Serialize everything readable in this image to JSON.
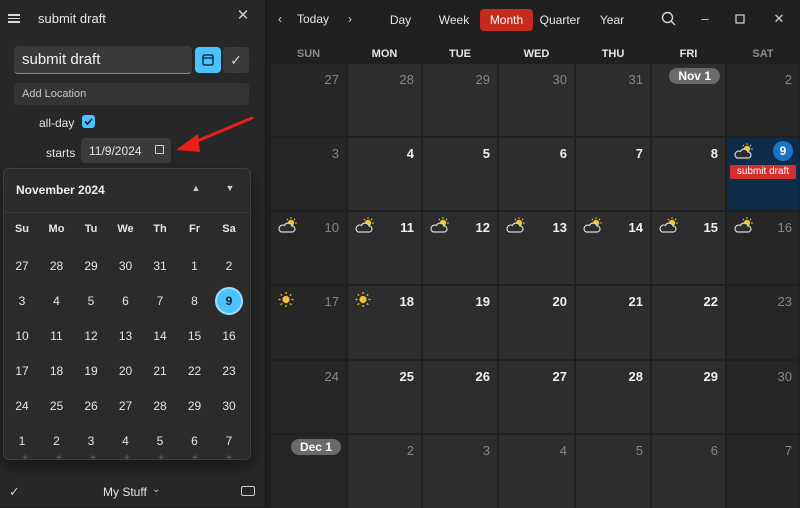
{
  "panel": {
    "title": "submit draft",
    "event_title": "submit draft",
    "location_placeholder": "Add Location",
    "allday_label": "all-day",
    "starts_label": "starts",
    "start_date": "11/9/2024",
    "footer_calendar": "My Stuff"
  },
  "picker": {
    "month_label": "November 2024",
    "weekdays": [
      "Su",
      "Mo",
      "Tu",
      "We",
      "Th",
      "Fr",
      "Sa"
    ],
    "weeks": [
      [
        "27",
        "28",
        "29",
        "30",
        "31",
        "1",
        "2"
      ],
      [
        "3",
        "4",
        "5",
        "6",
        "7",
        "8",
        "9"
      ],
      [
        "10",
        "11",
        "12",
        "13",
        "14",
        "15",
        "16"
      ],
      [
        "17",
        "18",
        "19",
        "20",
        "21",
        "22",
        "23"
      ],
      [
        "24",
        "25",
        "26",
        "27",
        "28",
        "29",
        "30"
      ],
      [
        "1",
        "2",
        "3",
        "4",
        "5",
        "6",
        "7"
      ]
    ],
    "selected_day": "9"
  },
  "toolbar": {
    "today": "Today",
    "views": [
      "Day",
      "Week",
      "Month",
      "Quarter",
      "Year"
    ],
    "active_view": "Month"
  },
  "calendar": {
    "weekday_headers": [
      "SUN",
      "MON",
      "TUE",
      "WED",
      "THU",
      "FRI",
      "SAT"
    ],
    "weeks": [
      [
        "27",
        "28",
        "29",
        "30",
        "31",
        "Nov 1",
        "2"
      ],
      [
        "3",
        "4",
        "5",
        "6",
        "7",
        "8",
        "9"
      ],
      [
        "10",
        "11",
        "12",
        "13",
        "14",
        "15",
        "16"
      ],
      [
        "17",
        "18",
        "19",
        "20",
        "21",
        "22",
        "23"
      ],
      [
        "24",
        "25",
        "26",
        "27",
        "28",
        "29",
        "30"
      ],
      [
        "Dec 1",
        "2",
        "3",
        "4",
        "5",
        "6",
        "7"
      ]
    ],
    "event": {
      "date": "9",
      "title": "submit draft",
      "color": "#d32f2f"
    },
    "weather": {
      "sun-cloud": [
        "9",
        "10",
        "11",
        "12",
        "13",
        "14",
        "15",
        "16"
      ],
      "sun": [
        "17",
        "18"
      ]
    },
    "accent": "#1d73c7",
    "selection_accent": "#4cc2ff"
  }
}
